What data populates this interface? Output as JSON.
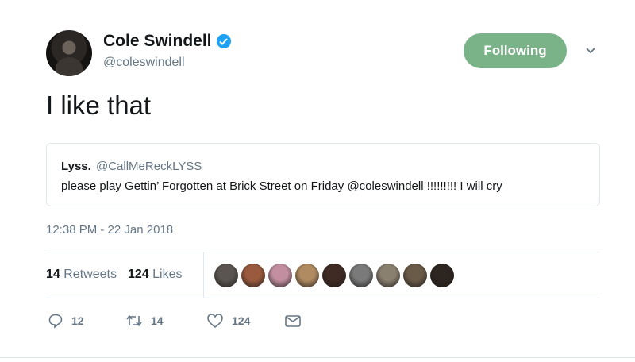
{
  "author": {
    "name": "Cole Swindell",
    "handle": "@coleswindell",
    "verified": true
  },
  "follow_button": {
    "label": "Following",
    "color": "#7ab388"
  },
  "tweet": {
    "text": "I like that"
  },
  "quoted_tweet": {
    "name": "Lyss.",
    "handle": "@CallMeReckLYSS",
    "text": "please play Gettin’ Forgotten at Brick Street on Friday @coleswindell !!!!!!!!! I will cry"
  },
  "timestamp": "12:38 PM - 22 Jan 2018",
  "stats": {
    "retweets_count": "14",
    "retweets_label": "Retweets",
    "likes_count": "124",
    "likes_label": "Likes"
  },
  "likers": [
    {
      "color": "#5a5550"
    },
    {
      "color": "#9a5a3e"
    },
    {
      "color": "#c28fa0"
    },
    {
      "color": "#b08a60"
    },
    {
      "color": "#3f2a24"
    },
    {
      "color": "#7a7a7a"
    },
    {
      "color": "#8a8070"
    },
    {
      "color": "#6a5a48"
    },
    {
      "color": "#2d2520"
    }
  ],
  "actions": {
    "reply_count": "12",
    "retweet_count": "14",
    "like_count": "124"
  },
  "colors": {
    "verified": "#1da1f2",
    "secondary_text": "#657786",
    "border": "#e1e8ed"
  }
}
